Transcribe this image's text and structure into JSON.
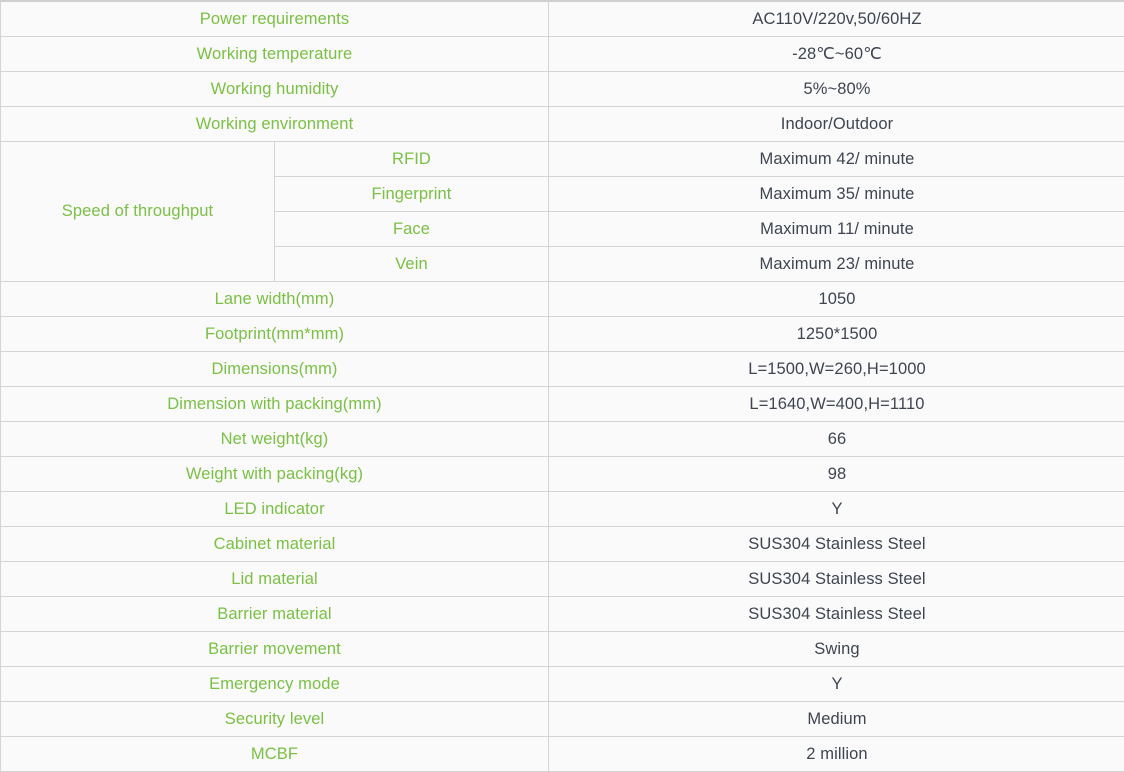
{
  "table": {
    "param_color": "#7ac143",
    "value_color": "#3f4550",
    "border_color": "#d4d4d4",
    "background": "#fafafa",
    "rows": [
      {
        "param": "Power requirements",
        "value": "AC110V/220v,50/60HZ"
      },
      {
        "param": "Working temperature",
        "value": "-28℃~60℃"
      },
      {
        "param": "Working humidity",
        "value": "5%~80%"
      },
      {
        "param": "Working environment",
        "value": "Indoor/Outdoor"
      }
    ],
    "throughput": {
      "label": "Speed of throughput",
      "items": [
        {
          "sub": "RFID",
          "value": "Maximum 42/ minute"
        },
        {
          "sub": "Fingerprint",
          "value": "Maximum 35/ minute"
        },
        {
          "sub": "Face",
          "value": "Maximum 11/ minute"
        },
        {
          "sub": "Vein",
          "value": "Maximum 23/ minute"
        }
      ]
    },
    "rows2": [
      {
        "param": "Lane width(mm)",
        "value": "1050"
      },
      {
        "param": "Footprint(mm*mm)",
        "value": "1250*1500"
      },
      {
        "param": "Dimensions(mm)",
        "value": "L=1500,W=260,H=1000"
      },
      {
        "param": "Dimension with packing(mm)",
        "value": "L=1640,W=400,H=1110"
      },
      {
        "param": "Net weight(kg)",
        "value": "66"
      },
      {
        "param": "Weight with packing(kg)",
        "value": "98"
      },
      {
        "param": "LED indicator",
        "value": "Y"
      },
      {
        "param": "Cabinet material",
        "value": "SUS304 Stainless Steel"
      },
      {
        "param": "Lid material",
        "value": "SUS304 Stainless Steel"
      },
      {
        "param": "Barrier material",
        "value": "SUS304 Stainless Steel"
      },
      {
        "param": "Barrier movement",
        "value": "Swing"
      },
      {
        "param": "Emergency mode",
        "value": "Y"
      },
      {
        "param": "Security level",
        "value": "Medium"
      },
      {
        "param": "MCBF",
        "value": "2 million"
      }
    ]
  }
}
